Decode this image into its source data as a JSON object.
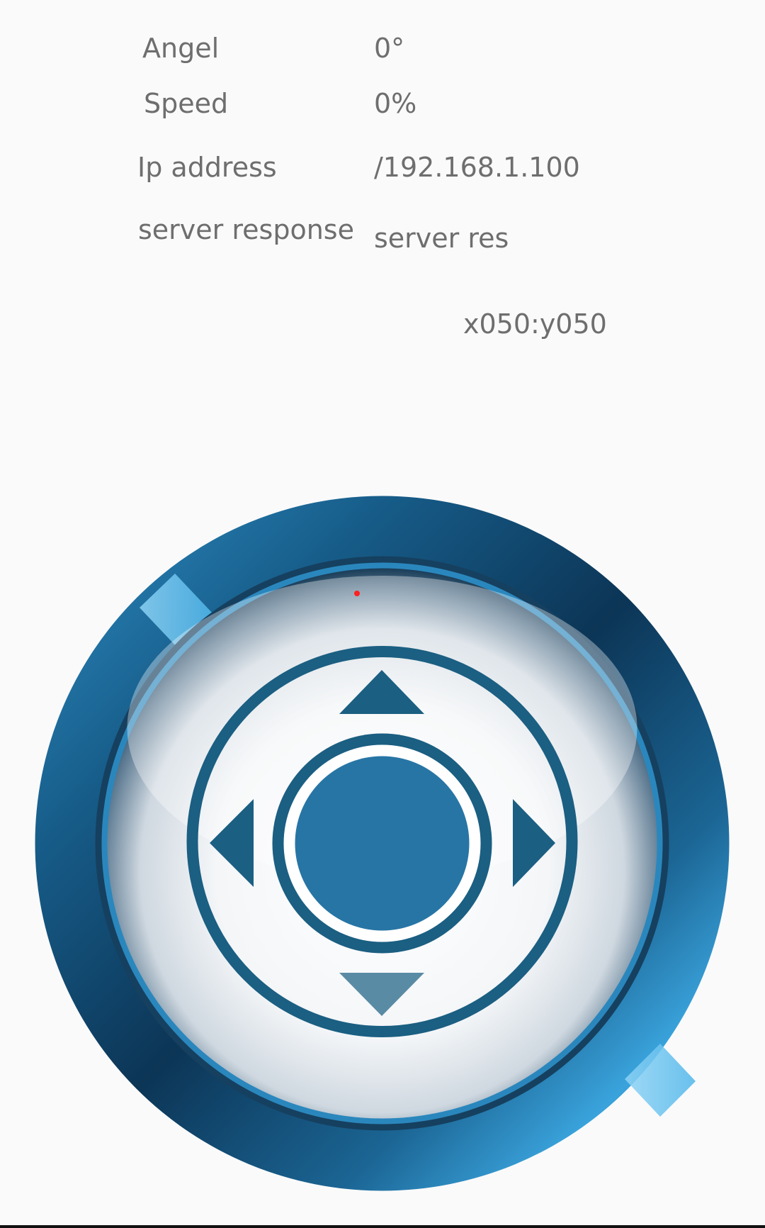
{
  "info": {
    "angle_label": "Angel",
    "angle_value": "0°",
    "speed_label": "Speed",
    "speed_value": "0%",
    "ip_label": "Ip address",
    "ip_value": "/192.168.1.100",
    "response_label": "server response",
    "response_value": "server res"
  },
  "joystick": {
    "coords": "x050:y050",
    "icons": {
      "up": "arrow-up-icon",
      "down": "arrow-down-icon",
      "left": "arrow-left-icon",
      "right": "arrow-right-icon"
    },
    "colors": {
      "ring_dark": "#0b2f4c",
      "ring_mid": "#1f6d99",
      "ring_light": "#6cc4ef",
      "arrow": "#1b5f82",
      "knob": "#2775a5",
      "indicator": "#ff2020"
    }
  },
  "theme": {
    "background": "#fafafa",
    "text": "#6e6e6e"
  }
}
